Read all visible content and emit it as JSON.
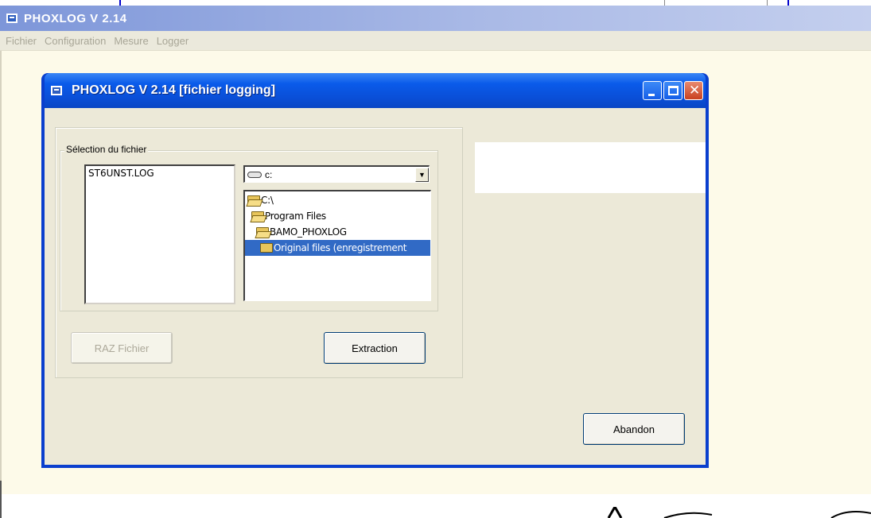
{
  "app": {
    "title": "PHOXLOG   V 2.14",
    "menu": [
      "Fichier",
      "Configuration",
      "Mesure",
      "Logger"
    ]
  },
  "dialog": {
    "title": "PHOXLOG   V 2.14 [fichier logging]",
    "window_buttons": [
      "minimize-icon",
      "maximize-icon",
      "close-icon"
    ],
    "fieldset_label": "Sélection du fichier",
    "files": [
      "ST6UNST.LOG"
    ],
    "drive": "c:",
    "directories": [
      {
        "label": "C:\\",
        "icon": "open-folder-icon",
        "selected": false
      },
      {
        "label": "Program Files",
        "icon": "open-folder-icon",
        "selected": false
      },
      {
        "label": "BAMO_PHOXLOG",
        "icon": "open-folder-icon",
        "selected": false
      },
      {
        "label": "Original files (enregistrement",
        "icon": "folder-icon",
        "selected": true
      }
    ],
    "buttons": {
      "raz": "RAZ Fichier",
      "extraction": "Extraction",
      "abandon": "Abandon"
    }
  },
  "colors": {
    "dialog_title": "#0a4fd8",
    "selection": "#316ac5",
    "client_bg": "#fdfae9"
  }
}
